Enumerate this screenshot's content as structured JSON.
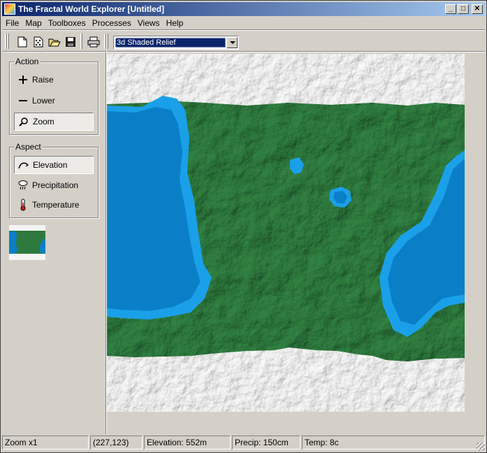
{
  "window": {
    "title": "The Fractal World Explorer [Untitled]",
    "controls": {
      "minimize": "_",
      "maximize": "□",
      "close": "✕"
    }
  },
  "menu": [
    {
      "label": "File"
    },
    {
      "label": "Map"
    },
    {
      "label": "Toolboxes"
    },
    {
      "label": "Processes"
    },
    {
      "label": "Views"
    },
    {
      "label": "Help"
    }
  ],
  "toolbar": {
    "buttons": [
      {
        "icon": "new-document-icon"
      },
      {
        "icon": "dice-icon"
      },
      {
        "icon": "open-folder-icon"
      },
      {
        "icon": "save-disk-icon"
      },
      {
        "icon": "printer-icon"
      }
    ],
    "view_select": {
      "selected": "3d Shaded Relief"
    }
  },
  "action_group": {
    "label": "Action",
    "buttons": [
      {
        "label": "Raise",
        "icon": "plus-icon",
        "pressed": false
      },
      {
        "label": "Lower",
        "icon": "minus-icon",
        "pressed": false
      },
      {
        "label": "Zoom",
        "icon": "magnifier-icon",
        "pressed": true
      }
    ]
  },
  "aspect_group": {
    "label": "Aspect",
    "buttons": [
      {
        "label": "Elevation",
        "icon": "elevation-icon",
        "pressed": true
      },
      {
        "label": "Precipitation",
        "icon": "rain-cloud-icon",
        "pressed": false
      },
      {
        "label": "Temperature",
        "icon": "thermometer-icon",
        "pressed": false
      }
    ]
  },
  "colors": {
    "ice": "#f4f4f4",
    "land": "#2e7a3e",
    "shallow_water": "#1aa0e8",
    "deep_water": "#0a7fc8",
    "selection": "#0a246a"
  },
  "status": {
    "zoom": "Zoom x1",
    "coords": "(227,123)",
    "elevation": "Elevation: 552m",
    "precip": "Precip: 150cm",
    "temp": "Temp: 8c"
  }
}
